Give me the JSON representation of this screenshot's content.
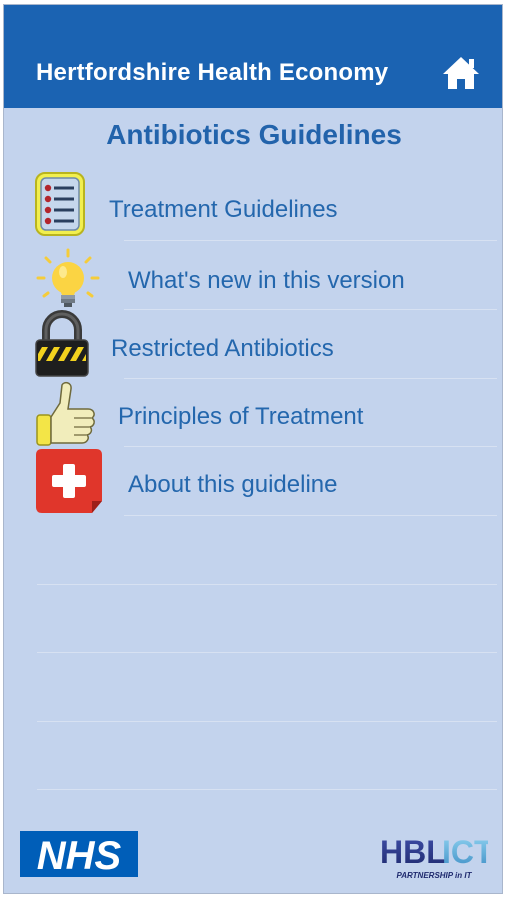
{
  "header": {
    "title": "Hertfordshire Health Economy",
    "home_icon": "home-icon"
  },
  "page": {
    "heading": "Antibiotics Guidelines"
  },
  "menu": {
    "items": [
      {
        "label": "Treatment Guidelines",
        "icon": "checklist-icon"
      },
      {
        "label": "What's new in this version",
        "icon": "lightbulb-icon"
      },
      {
        "label": "Restricted Antibiotics",
        "icon": "padlock-icon"
      },
      {
        "label": "Principles of Treatment",
        "icon": "thumbs-up-icon"
      },
      {
        "label": "About this guideline",
        "icon": "first-aid-icon"
      }
    ]
  },
  "footer": {
    "nhs_logo_text": "NHS",
    "partner_logo_text": "HBL ICT",
    "partner_tagline": "PARTNERSHIP in IT"
  },
  "colors": {
    "header_bg": "#1b63b2",
    "page_bg": "#c3d3ed",
    "link_text": "#2467ad",
    "nhs_blue": "#005eb8"
  }
}
